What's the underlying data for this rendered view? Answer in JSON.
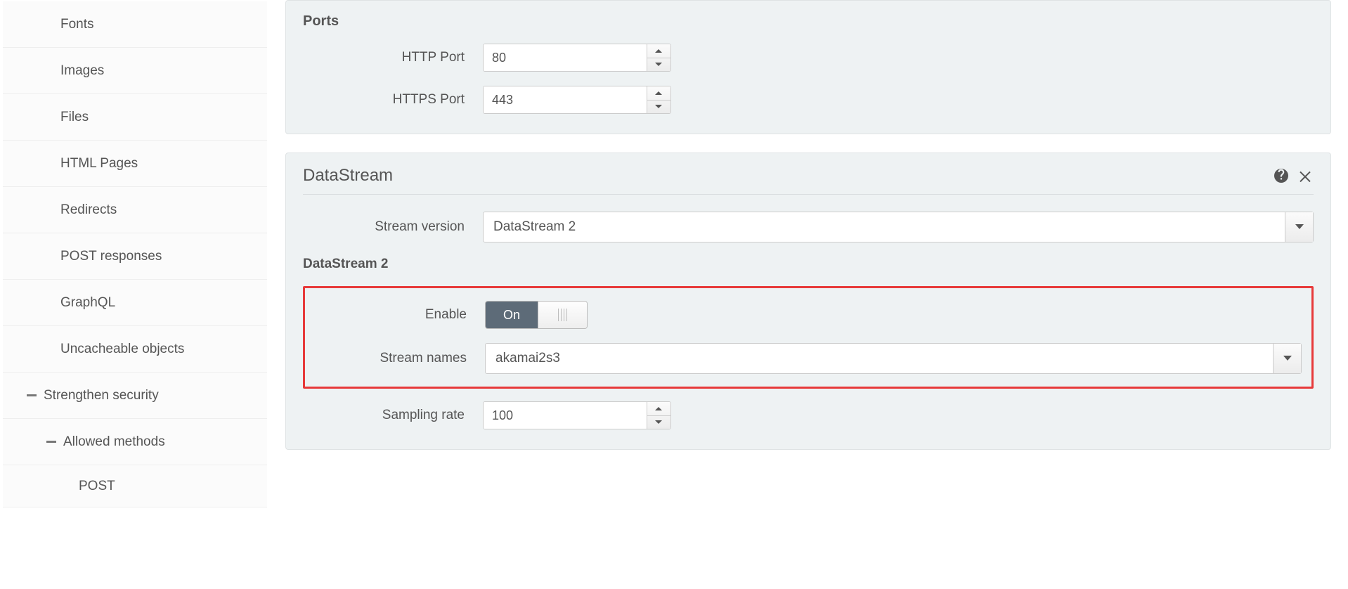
{
  "sidebar": {
    "items": [
      {
        "label": "Fonts"
      },
      {
        "label": "Images"
      },
      {
        "label": "Files"
      },
      {
        "label": "HTML Pages"
      },
      {
        "label": "Redirects"
      },
      {
        "label": "POST responses"
      },
      {
        "label": "GraphQL"
      },
      {
        "label": "Uncacheable objects"
      }
    ],
    "group": {
      "label": "Strengthen security"
    },
    "subgroup": {
      "label": "Allowed methods"
    },
    "subitems": [
      {
        "label": "POST"
      }
    ]
  },
  "ports": {
    "heading": "Ports",
    "http_label": "HTTP Port",
    "http_value": "80",
    "https_label": "HTTPS Port",
    "https_value": "443"
  },
  "datastream": {
    "title": "DataStream",
    "stream_version_label": "Stream version",
    "stream_version_value": "DataStream 2",
    "section_label": "DataStream 2",
    "enable_label": "Enable",
    "enable_value": "On",
    "stream_names_label": "Stream names",
    "stream_names_value": "akamai2s3",
    "sampling_rate_label": "Sampling rate",
    "sampling_rate_value": "100"
  }
}
